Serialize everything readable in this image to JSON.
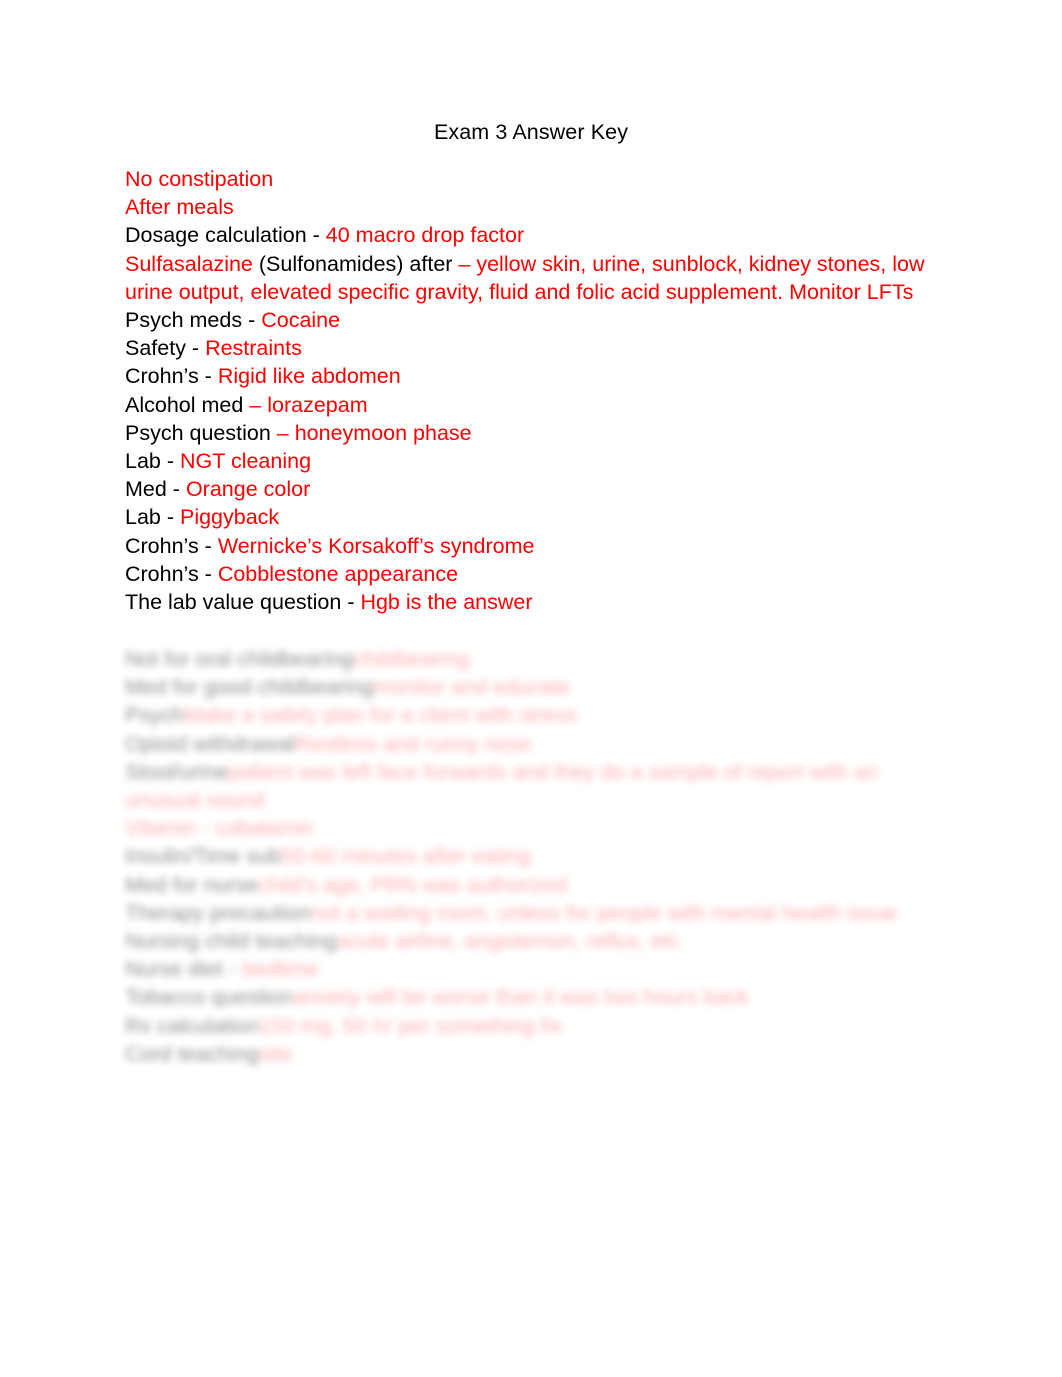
{
  "document": {
    "title": "Exam 3 Answer Key",
    "page_background": "#ffffff",
    "text_color": "#000000",
    "answer_color": "#ff0000",
    "visible_lines": [
      {
        "prompt": "",
        "sep": "",
        "answer": "No constipation"
      },
      {
        "prompt": "",
        "sep": "",
        "answer": "After meals"
      },
      {
        "prompt": "Dosage calculation",
        "sep": " - ",
        "answer": "40 macro drop factor"
      },
      {
        "prompt": "",
        "sep": "",
        "answer": "Sulfasalazine",
        "mixed": true,
        "mixed_runs": [
          {
            "text": "Sulfasalazine",
            "color": "red"
          },
          {
            "text": " (Sulfonamides) after ",
            "color": "black"
          },
          {
            "text": "– yellow skin, urine, sunblock, kidney stones, low urine output, elevated specific gravity, fluid and folic acid supplement. Monitor LFTs",
            "color": "red"
          }
        ]
      },
      {
        "prompt": "Psych meds",
        "sep": " - ",
        "answer": "Cocaine"
      },
      {
        "prompt": "Safety",
        "sep": " - ",
        "answer": "Restraints"
      },
      {
        "prompt": "Crohn’s",
        "sep": " - ",
        "answer": "Rigid like abdomen"
      },
      {
        "prompt": "Alcohol med",
        "sep": " ",
        "answer": "– lorazepam"
      },
      {
        "prompt": "Psych question",
        "sep": " ",
        "answer": "– honeymoon phase"
      },
      {
        "prompt": "Lab",
        "sep": " - ",
        "answer": "NGT cleaning"
      },
      {
        "prompt": "Med",
        "sep": " - ",
        "answer": "Orange color"
      },
      {
        "prompt": "Lab",
        "sep": " - ",
        "answer": "Piggyback"
      },
      {
        "prompt": "Crohn’s",
        "sep": " - ",
        "answer": "Wernicke’s Korsakoff’s syndrome"
      },
      {
        "prompt": "Crohn’s",
        "sep": " - ",
        "answer": "Cobblestone appearance"
      },
      {
        "prompt": "The lab value question",
        "sep": " - ",
        "answer": "Hgb is the answer"
      }
    ],
    "obscured_note": "lower block is blurred and faded in the screenshot; text is not legible",
    "obscured_lines": [
      {
        "prompt": "Not for oral childbearing",
        "tab": "\t\t",
        "answer": "childbearing"
      },
      {
        "prompt": "Med for good childbearing",
        "tab": "\t\t",
        "answer": "monitor and educate"
      },
      {
        "prompt": "Psych",
        "tab": "\t\t",
        "answer": "Make a safety plan for a client with stress"
      },
      {
        "prompt": "Opioid withdrawal",
        "tab": "\t\t",
        "answer": "Restless and runny nose"
      },
      {
        "prompt": "Stool/urine",
        "tab": "\t\t",
        "answer": "patient was left face forwards and they do a sample of report with an unusual sound"
      },
      {
        "prompt": "Vitamin",
        "tab": " - ",
        "answer": "cobalamin"
      },
      {
        "prompt": "Insulin/Time sub",
        "tab": "\t\t",
        "answer": "50-60 minutes after eating"
      },
      {
        "prompt": "Med for nurse",
        "tab": "\t\t",
        "answer": "child’s age, PRN was authorized"
      },
      {
        "prompt": "Therapy precaution",
        "tab": "\t\t",
        "answer": "not a waiting room, unless for people with mental health issue"
      },
      {
        "prompt": "Nursing child teaching",
        "tab": "\t\t",
        "answer": "acute airline, angiotensin, reflux, etc"
      },
      {
        "prompt": "Nurse diet",
        "tab": " - ",
        "answer": "bedtime"
      },
      {
        "prompt": "Tobacco question",
        "tab": "\t\t",
        "answer": "anxiety will be worse than it was two hours back"
      },
      {
        "prompt": "Rx calculation",
        "tab": "\t\t",
        "answer": "150 mg, 50 IV per something fix"
      },
      {
        "prompt": "Cord teaching",
        "tab": "\t\t",
        "answer": "site"
      }
    ]
  }
}
